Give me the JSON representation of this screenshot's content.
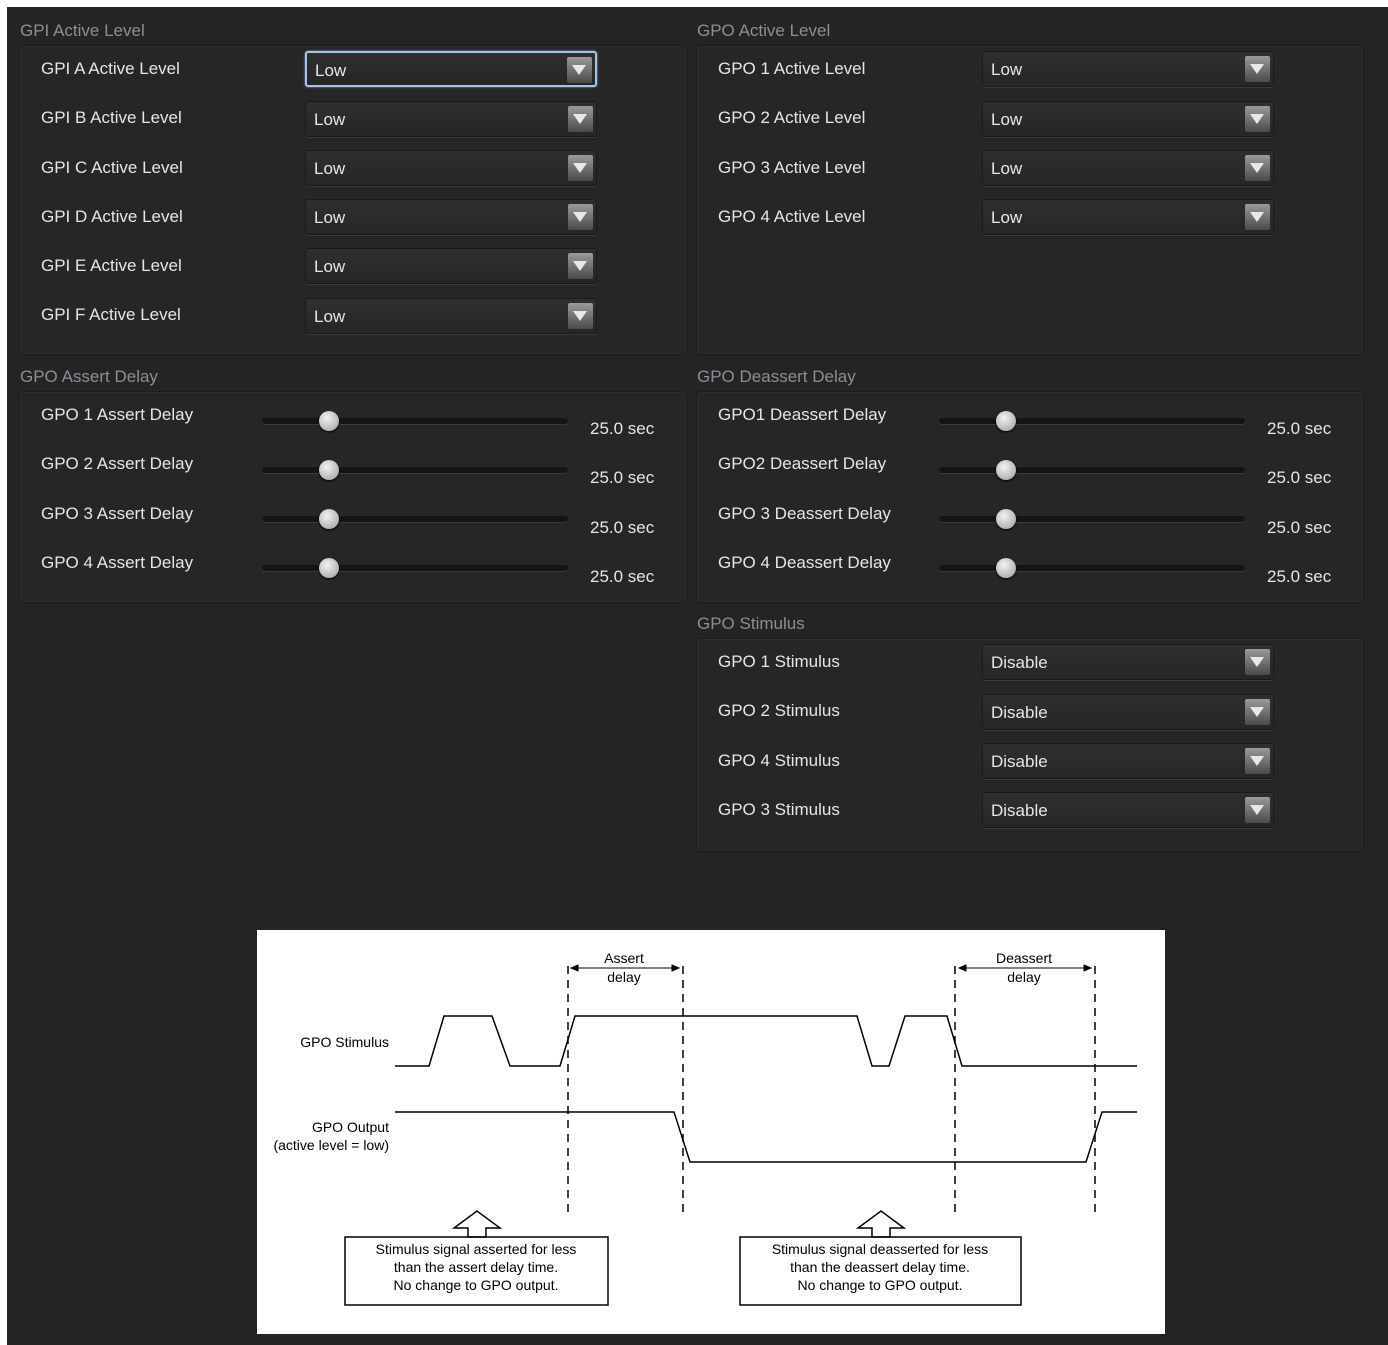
{
  "gpi_active_level": {
    "title": "GPI Active Level",
    "rows": [
      {
        "label": "GPI A Active Level",
        "value": "Low"
      },
      {
        "label": "GPI B Active Level",
        "value": "Low"
      },
      {
        "label": "GPI C Active Level",
        "value": "Low"
      },
      {
        "label": "GPI D Active Level",
        "value": "Low"
      },
      {
        "label": "GPI E Active Level",
        "value": "Low"
      },
      {
        "label": "GPI F Active Level",
        "value": "Low"
      }
    ]
  },
  "gpo_active_level": {
    "title": "GPO Active Level",
    "rows": [
      {
        "label": "GPO 1 Active Level",
        "value": "Low"
      },
      {
        "label": "GPO 2 Active Level",
        "value": "Low"
      },
      {
        "label": "GPO 3 Active Level",
        "value": "Low"
      },
      {
        "label": "GPO 4 Active Level",
        "value": "Low"
      }
    ]
  },
  "gpo_assert_delay": {
    "title": "GPO Assert Delay",
    "rows": [
      {
        "label": "GPO 1 Assert Delay",
        "value": "25.0 sec",
        "level": 0.2
      },
      {
        "label": "GPO 2 Assert Delay",
        "value": "25.0 sec",
        "level": 0.2
      },
      {
        "label": "GPO 3 Assert Delay",
        "value": "25.0 sec",
        "level": 0.2
      },
      {
        "label": "GPO 4 Assert Delay",
        "value": "25.0 sec",
        "level": 0.2
      }
    ]
  },
  "gpo_deassert_delay": {
    "title": "GPO Deassert Delay",
    "rows": [
      {
        "label": "GPO1 Deassert Delay",
        "value": "25.0 sec",
        "level": 0.2
      },
      {
        "label": "GPO2 Deassert Delay",
        "value": "25.0 sec",
        "level": 0.2
      },
      {
        "label": "GPO 3 Deassert Delay",
        "value": "25.0 sec",
        "level": 0.2
      },
      {
        "label": "GPO 4 Deassert Delay",
        "value": "25.0 sec",
        "level": 0.2
      }
    ]
  },
  "gpo_stimulus": {
    "title": "GPO Stimulus",
    "rows": [
      {
        "label": "GPO 1 Stimulus",
        "value": "Disable"
      },
      {
        "label": "GPO 2 Stimulus",
        "value": "Disable"
      },
      {
        "label": "GPO 4 Stimulus",
        "value": "Disable"
      },
      {
        "label": "GPO 3 Stimulus",
        "value": "Disable"
      }
    ]
  },
  "diagram": {
    "assert_delay_1": "Assert",
    "assert_delay_2": "delay",
    "deassert_delay_1": "Deassert",
    "deassert_delay_2": "delay",
    "stimulus_label": "GPO Stimulus",
    "output_label_1": "GPO Output",
    "output_label_2": "(active level = low)",
    "note1_line1": "Stimulus signal asserted for less",
    "note1_line2": "than the assert delay time.",
    "note1_line3": "No change to GPO output.",
    "note2_line1": "Stimulus signal deasserted for less",
    "note2_line2": "than the deassert delay time.",
    "note2_line3": "No change to GPO output."
  },
  "colors": {
    "background": "#242424",
    "section_title": "#8a8f97",
    "focus_ring": "#a8c4e4"
  }
}
